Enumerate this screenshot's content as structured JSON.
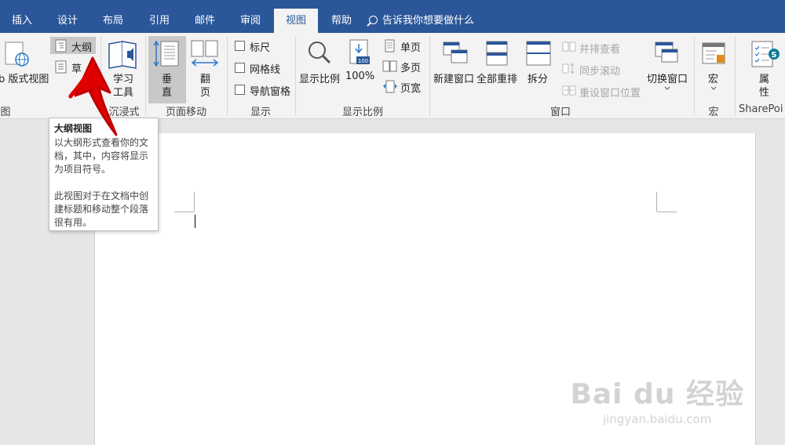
{
  "tabs": [
    "插入",
    "设计",
    "布局",
    "引用",
    "邮件",
    "审阅",
    "视图",
    "帮助"
  ],
  "active_tab": "视图",
  "tell_me": "告诉我你想要做什么",
  "views": {
    "web_layout": "b 版式视图",
    "outline": "大纲",
    "draft": "草",
    "group_label": "图"
  },
  "immersive": {
    "learning_tools_line1": "学习",
    "learning_tools_line2": "工具",
    "group_label": "沉浸式"
  },
  "page_movement": {
    "vertical_line1": "垂",
    "vertical_line2": "直",
    "side_line1": "翻",
    "side_line2": "页",
    "group_label": "页面移动"
  },
  "show": {
    "ruler": "标尺",
    "gridlines": "网格线",
    "nav_pane": "导航窗格",
    "group_label": "显示"
  },
  "zoom": {
    "zoom": "显示比例",
    "hundred": "100%",
    "hundred_icon_text": "100",
    "one_page": "单页",
    "multi_page": "多页",
    "page_width": "页宽",
    "group_label": "显示比例"
  },
  "window": {
    "new_window": "新建窗口",
    "arrange_all": "全部重排",
    "split": "拆分",
    "side_by_side": "并排查看",
    "sync_scroll": "同步滚动",
    "reset_position": "重设窗口位置",
    "switch_windows": "切换窗口",
    "group_label": "窗口"
  },
  "macros": {
    "macros": "宏",
    "group_label": "宏"
  },
  "sharepoint": {
    "properties_line1": "属",
    "properties_line2": "性",
    "group_label": "SharePoi"
  },
  "tooltip": {
    "title": "大纲视图",
    "para1": "以大纲形式查看你的文档，其中，内容将显示为项目符号。",
    "para2": "此视图对于在文档中创建标题和移动整个段落很有用。"
  },
  "watermark": {
    "brand": "Bai du 经验",
    "url": "jingyan.baidu.com"
  },
  "colors": {
    "tab_bar": "#2b579a",
    "ribbon": "#f3f3f3",
    "annotation_arrow": "#e00000"
  }
}
